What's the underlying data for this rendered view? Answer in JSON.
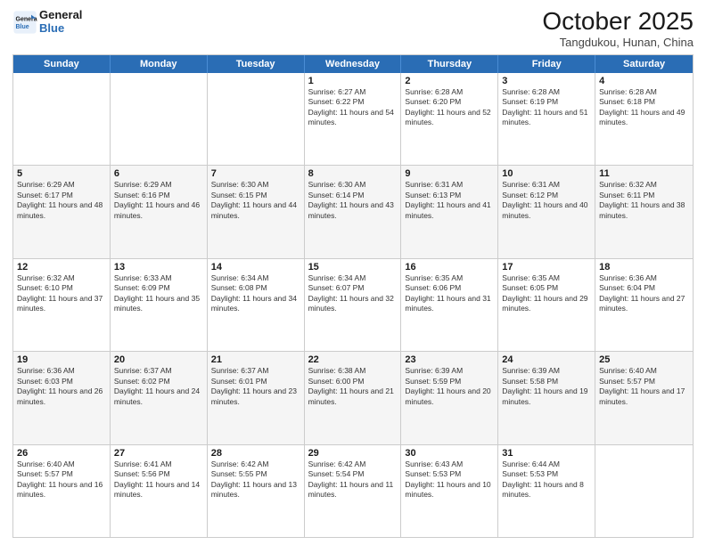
{
  "header": {
    "logo_line1": "General",
    "logo_line2": "Blue",
    "month_title": "October 2025",
    "location": "Tangdukou, Hunan, China"
  },
  "weekdays": [
    "Sunday",
    "Monday",
    "Tuesday",
    "Wednesday",
    "Thursday",
    "Friday",
    "Saturday"
  ],
  "weeks": [
    [
      {
        "day": "",
        "sunrise": "",
        "sunset": "",
        "daylight": "",
        "empty": true
      },
      {
        "day": "",
        "sunrise": "",
        "sunset": "",
        "daylight": "",
        "empty": true
      },
      {
        "day": "",
        "sunrise": "",
        "sunset": "",
        "daylight": "",
        "empty": true
      },
      {
        "day": "1",
        "sunrise": "Sunrise: 6:27 AM",
        "sunset": "Sunset: 6:22 PM",
        "daylight": "Daylight: 11 hours and 54 minutes."
      },
      {
        "day": "2",
        "sunrise": "Sunrise: 6:28 AM",
        "sunset": "Sunset: 6:20 PM",
        "daylight": "Daylight: 11 hours and 52 minutes."
      },
      {
        "day": "3",
        "sunrise": "Sunrise: 6:28 AM",
        "sunset": "Sunset: 6:19 PM",
        "daylight": "Daylight: 11 hours and 51 minutes."
      },
      {
        "day": "4",
        "sunrise": "Sunrise: 6:28 AM",
        "sunset": "Sunset: 6:18 PM",
        "daylight": "Daylight: 11 hours and 49 minutes."
      }
    ],
    [
      {
        "day": "5",
        "sunrise": "Sunrise: 6:29 AM",
        "sunset": "Sunset: 6:17 PM",
        "daylight": "Daylight: 11 hours and 48 minutes."
      },
      {
        "day": "6",
        "sunrise": "Sunrise: 6:29 AM",
        "sunset": "Sunset: 6:16 PM",
        "daylight": "Daylight: 11 hours and 46 minutes."
      },
      {
        "day": "7",
        "sunrise": "Sunrise: 6:30 AM",
        "sunset": "Sunset: 6:15 PM",
        "daylight": "Daylight: 11 hours and 44 minutes."
      },
      {
        "day": "8",
        "sunrise": "Sunrise: 6:30 AM",
        "sunset": "Sunset: 6:14 PM",
        "daylight": "Daylight: 11 hours and 43 minutes."
      },
      {
        "day": "9",
        "sunrise": "Sunrise: 6:31 AM",
        "sunset": "Sunset: 6:13 PM",
        "daylight": "Daylight: 11 hours and 41 minutes."
      },
      {
        "day": "10",
        "sunrise": "Sunrise: 6:31 AM",
        "sunset": "Sunset: 6:12 PM",
        "daylight": "Daylight: 11 hours and 40 minutes."
      },
      {
        "day": "11",
        "sunrise": "Sunrise: 6:32 AM",
        "sunset": "Sunset: 6:11 PM",
        "daylight": "Daylight: 11 hours and 38 minutes."
      }
    ],
    [
      {
        "day": "12",
        "sunrise": "Sunrise: 6:32 AM",
        "sunset": "Sunset: 6:10 PM",
        "daylight": "Daylight: 11 hours and 37 minutes."
      },
      {
        "day": "13",
        "sunrise": "Sunrise: 6:33 AM",
        "sunset": "Sunset: 6:09 PM",
        "daylight": "Daylight: 11 hours and 35 minutes."
      },
      {
        "day": "14",
        "sunrise": "Sunrise: 6:34 AM",
        "sunset": "Sunset: 6:08 PM",
        "daylight": "Daylight: 11 hours and 34 minutes."
      },
      {
        "day": "15",
        "sunrise": "Sunrise: 6:34 AM",
        "sunset": "Sunset: 6:07 PM",
        "daylight": "Daylight: 11 hours and 32 minutes."
      },
      {
        "day": "16",
        "sunrise": "Sunrise: 6:35 AM",
        "sunset": "Sunset: 6:06 PM",
        "daylight": "Daylight: 11 hours and 31 minutes."
      },
      {
        "day": "17",
        "sunrise": "Sunrise: 6:35 AM",
        "sunset": "Sunset: 6:05 PM",
        "daylight": "Daylight: 11 hours and 29 minutes."
      },
      {
        "day": "18",
        "sunrise": "Sunrise: 6:36 AM",
        "sunset": "Sunset: 6:04 PM",
        "daylight": "Daylight: 11 hours and 27 minutes."
      }
    ],
    [
      {
        "day": "19",
        "sunrise": "Sunrise: 6:36 AM",
        "sunset": "Sunset: 6:03 PM",
        "daylight": "Daylight: 11 hours and 26 minutes."
      },
      {
        "day": "20",
        "sunrise": "Sunrise: 6:37 AM",
        "sunset": "Sunset: 6:02 PM",
        "daylight": "Daylight: 11 hours and 24 minutes."
      },
      {
        "day": "21",
        "sunrise": "Sunrise: 6:37 AM",
        "sunset": "Sunset: 6:01 PM",
        "daylight": "Daylight: 11 hours and 23 minutes."
      },
      {
        "day": "22",
        "sunrise": "Sunrise: 6:38 AM",
        "sunset": "Sunset: 6:00 PM",
        "daylight": "Daylight: 11 hours and 21 minutes."
      },
      {
        "day": "23",
        "sunrise": "Sunrise: 6:39 AM",
        "sunset": "Sunset: 5:59 PM",
        "daylight": "Daylight: 11 hours and 20 minutes."
      },
      {
        "day": "24",
        "sunrise": "Sunrise: 6:39 AM",
        "sunset": "Sunset: 5:58 PM",
        "daylight": "Daylight: 11 hours and 19 minutes."
      },
      {
        "day": "25",
        "sunrise": "Sunrise: 6:40 AM",
        "sunset": "Sunset: 5:57 PM",
        "daylight": "Daylight: 11 hours and 17 minutes."
      }
    ],
    [
      {
        "day": "26",
        "sunrise": "Sunrise: 6:40 AM",
        "sunset": "Sunset: 5:57 PM",
        "daylight": "Daylight: 11 hours and 16 minutes."
      },
      {
        "day": "27",
        "sunrise": "Sunrise: 6:41 AM",
        "sunset": "Sunset: 5:56 PM",
        "daylight": "Daylight: 11 hours and 14 minutes."
      },
      {
        "day": "28",
        "sunrise": "Sunrise: 6:42 AM",
        "sunset": "Sunset: 5:55 PM",
        "daylight": "Daylight: 11 hours and 13 minutes."
      },
      {
        "day": "29",
        "sunrise": "Sunrise: 6:42 AM",
        "sunset": "Sunset: 5:54 PM",
        "daylight": "Daylight: 11 hours and 11 minutes."
      },
      {
        "day": "30",
        "sunrise": "Sunrise: 6:43 AM",
        "sunset": "Sunset: 5:53 PM",
        "daylight": "Daylight: 11 hours and 10 minutes."
      },
      {
        "day": "31",
        "sunrise": "Sunrise: 6:44 AM",
        "sunset": "Sunset: 5:53 PM",
        "daylight": "Daylight: 11 hours and 8 minutes."
      },
      {
        "day": "",
        "sunrise": "",
        "sunset": "",
        "daylight": "",
        "empty": true
      }
    ]
  ]
}
